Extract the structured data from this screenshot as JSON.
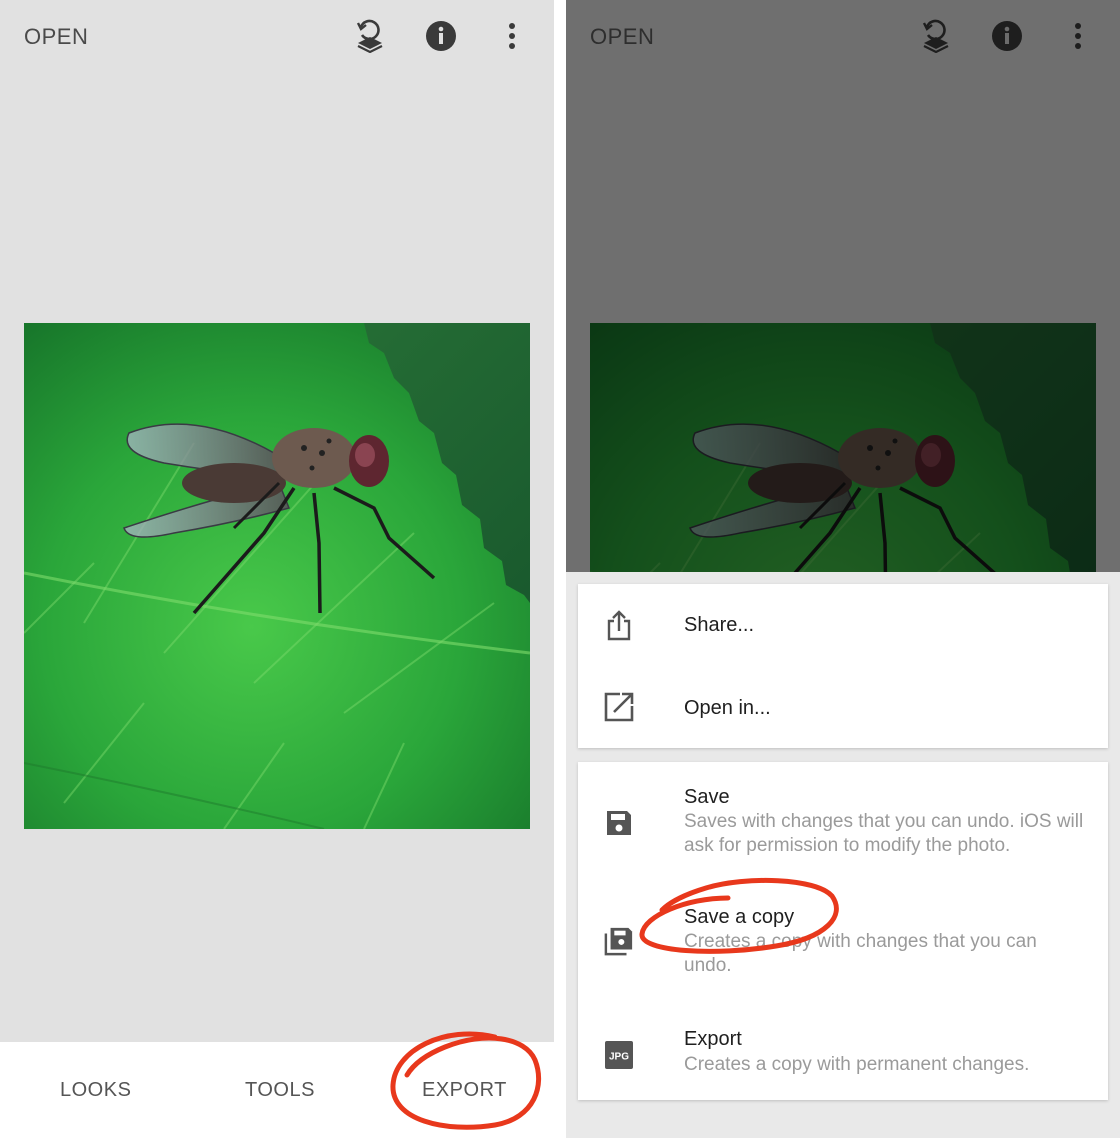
{
  "left": {
    "topbar": {
      "open_label": "OPEN"
    },
    "icons": [
      "layers-undo-icon",
      "info-icon",
      "more-vert-icon"
    ],
    "tabs": {
      "looks": "LOOKS",
      "tools": "TOOLS",
      "export": "EXPORT"
    }
  },
  "right": {
    "topbar": {
      "open_label": "OPEN"
    },
    "menu_group_1": [
      {
        "icon": "share-icon",
        "title": "Share..."
      },
      {
        "icon": "open-in-icon",
        "title": "Open in..."
      }
    ],
    "menu_group_2": [
      {
        "icon": "save-icon",
        "title": "Save",
        "desc": "Saves with changes that you can undo. iOS will ask for permission to modify the photo."
      },
      {
        "icon": "save-copy-icon",
        "title": "Save a copy",
        "desc": "Creates a copy with changes that you can undo."
      },
      {
        "icon": "jpg-icon",
        "title": "Export",
        "desc": "Creates a copy with permanent changes.",
        "badge": "JPG"
      }
    ]
  },
  "colors": {
    "annotation": "#e8381c",
    "leaf_green": "#2fae3c",
    "menu_text": "#1f1f1f",
    "menu_desc": "#9a9a9a"
  }
}
